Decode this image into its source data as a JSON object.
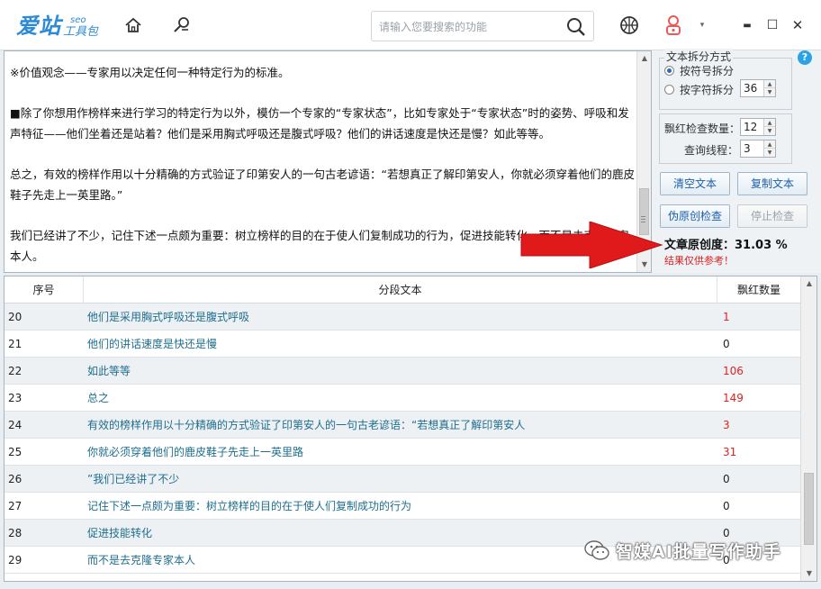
{
  "app": {
    "logo_main": "爱站",
    "logo_seo": "seo",
    "logo_tool": "工具包"
  },
  "toolbar": {
    "search_placeholder": "请输入您要搜索的功能",
    "minimize": "▬",
    "maximize": "☐",
    "close": "✕",
    "dropdown": "▾"
  },
  "editor": {
    "paragraphs": [
      "※价值观念——专家用以决定任何一种特定行为的标准。",
      "■除了你想用作榜样来进行学习的特定行为以外，模仿一个专家的“专家状态”，比如专家处于“专家状态”时的姿势、呼吸和发声特征——他们坐着还是站着？他们是采用胸式呼吸还是腹式呼吸？他们的讲话速度是快还是慢？如此等等。",
      "总之，有效的榜样作用以十分精确的方式验证了印第安人的一句古老谚语：“若想真正了解印第安人，你就必须穿着他们的鹿皮鞋子先走上一英里路。”",
      "我们已经讲了不少，记住下述一点颇为重要：树立榜样的目的在于使人们复制成功的行为，促进技能转化，而不是去克隆专家本人。"
    ]
  },
  "panel": {
    "split_title": "文本拆分方式",
    "split_by_symbol": "按符号拆分",
    "split_by_chars": "按字符拆分",
    "chars_value": "36",
    "check_count_label": "飘红检查数量：",
    "check_count_value": "12",
    "threads_label": "查询线程：",
    "threads_value": "3",
    "help": "?",
    "btn_clear": "清空文本",
    "btn_copy": "复制文本",
    "btn_check": "伪原创检查",
    "btn_stop": "停止检查",
    "score_text": "文章原创度：31.03 %",
    "note": "结果仅供参考！"
  },
  "table": {
    "headers": [
      "序号",
      "分段文本",
      "飘红数量"
    ],
    "rows": [
      {
        "num": "20",
        "text": "他们是采用胸式呼吸还是腹式呼吸",
        "count": "1",
        "red": true
      },
      {
        "num": "21",
        "text": "他们的讲话速度是快还是慢",
        "count": "0",
        "red": false
      },
      {
        "num": "22",
        "text": "如此等等",
        "count": "106",
        "red": true
      },
      {
        "num": "23",
        "text": "总之",
        "count": "149",
        "red": true
      },
      {
        "num": "24",
        "text": "有效的榜样作用以十分精确的方式验证了印第安人的一句古老谚语：“若想真正了解印第安人",
        "count": "3",
        "red": true
      },
      {
        "num": "25",
        "text": "你就必须穿着他们的鹿皮鞋子先走上一英里路",
        "count": "31",
        "red": true
      },
      {
        "num": "26",
        "text": "”我们已经讲了不少",
        "count": "0",
        "red": false
      },
      {
        "num": "27",
        "text": "记住下述一点颇为重要：树立榜样的目的在于使人们复制成功的行为",
        "count": "0",
        "red": false
      },
      {
        "num": "28",
        "text": "促进技能转化",
        "count": "0",
        "red": false
      },
      {
        "num": "29",
        "text": "而不是去克隆专家本人",
        "count": "0",
        "red": false
      }
    ]
  },
  "watermark": {
    "text": "智媒AI批量写作助手"
  },
  "colors": {
    "accent": "#2d8bd6",
    "red": "#d22222",
    "arrow": "#e01a1a",
    "link_text": "#1e6e8e"
  }
}
